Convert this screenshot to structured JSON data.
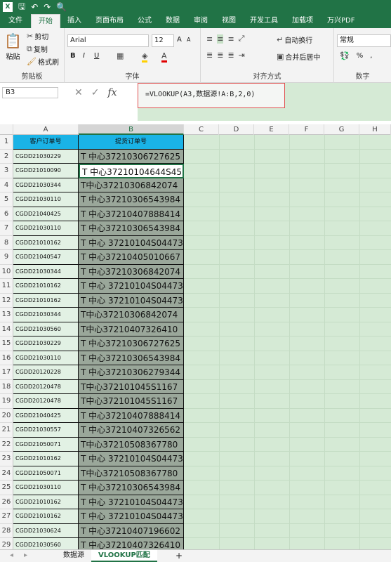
{
  "qat": {
    "logo": "X",
    "save": "🖫",
    "undo": "↶",
    "redo": "↷",
    "preview": "🔍"
  },
  "tabs": [
    "文件",
    "开始",
    "插入",
    "页面布局",
    "公式",
    "数据",
    "审阅",
    "视图",
    "开发工具",
    "加载项",
    "万兴PDF"
  ],
  "ribbon": {
    "clipboard": {
      "paste": "粘贴",
      "cut": "剪切",
      "copy": "复制",
      "painter": "格式刷",
      "label": "剪贴板"
    },
    "font": {
      "name": "Arial",
      "size": "12",
      "bold": "B",
      "italic": "I",
      "underline": "U",
      "grow": "A",
      "shrink": "A",
      "label": "字体"
    },
    "align": {
      "wrap": "自动换行",
      "merge": "合并后居中",
      "label": "对齐方式"
    },
    "number": {
      "format": "常规",
      "percent": "%",
      "comma": ",",
      "label": "数字"
    }
  },
  "namebox": "B3",
  "formula": "=VLOOKUP(A3,数据源!A:B,2,0)",
  "columns": [
    "A",
    "B",
    "C",
    "D",
    "E",
    "F",
    "G",
    "H"
  ],
  "header": {
    "a": "客户订单号",
    "b": "提货订单号"
  },
  "rows": [
    {
      "n": "1",
      "a": "",
      "b": ""
    },
    {
      "n": "2",
      "a": "CGDD21030229",
      "b": "T 中心37210306727625"
    },
    {
      "n": "3",
      "a": "CGDD21010090",
      "b": "T 中心37210104644S45"
    },
    {
      "n": "4",
      "a": "CGDD21030344",
      "b": "T中心37210306842074"
    },
    {
      "n": "5",
      "a": "CGDD21030110",
      "b": "T 中心37210306543984"
    },
    {
      "n": "6",
      "a": "CGDD21040425",
      "b": "T 中心37210407888414"
    },
    {
      "n": "7",
      "a": "CGDD21030110",
      "b": "T 中心37210306543984"
    },
    {
      "n": "8",
      "a": "CGDD21010162",
      "b": "T 中心 37210104S04473"
    },
    {
      "n": "9",
      "a": "CGDD21040547",
      "b": "T 中心37210405010667"
    },
    {
      "n": "10",
      "a": "CGDD21030344",
      "b": "T 中心37210306842074"
    },
    {
      "n": "11",
      "a": "CGDD21010162",
      "b": "T 中心 37210104S04473"
    },
    {
      "n": "12",
      "a": "CGDD21010162",
      "b": "T 中心 37210104S04473"
    },
    {
      "n": "13",
      "a": "CGDD21030344",
      "b": "T中心37210306842074"
    },
    {
      "n": "14",
      "a": "CGDD21030560",
      "b": "T中心37210407326410"
    },
    {
      "n": "15",
      "a": "CGDD21030229",
      "b": "T 中心37210306727625"
    },
    {
      "n": "16",
      "a": "CGDD21030110",
      "b": "T 中心37210306543984"
    },
    {
      "n": "17",
      "a": "CGDD20120228",
      "b": "T 中心37210306279344"
    },
    {
      "n": "18",
      "a": "CGDD20120478",
      "b": "T中心372101045S1167"
    },
    {
      "n": "19",
      "a": "CGDD20120478",
      "b": "T中心372101045S1167"
    },
    {
      "n": "20",
      "a": "CGDD21040425",
      "b": "T 中心37210407888414"
    },
    {
      "n": "21",
      "a": "CGDD21030557",
      "b": "T 中心37210407326562"
    },
    {
      "n": "22",
      "a": "CGDD21050071",
      "b": "T中心37210508367780"
    },
    {
      "n": "23",
      "a": "CGDD21010162",
      "b": "T 中心 37210104S04473"
    },
    {
      "n": "24",
      "a": "CGDD21050071",
      "b": "T中心37210508367780"
    },
    {
      "n": "25",
      "a": "CGDD21030110",
      "b": "T 中心37210306543984"
    },
    {
      "n": "26",
      "a": "CGDD21010162",
      "b": "T 中心 37210104S04473"
    },
    {
      "n": "27",
      "a": "CGDD21010162",
      "b": "T 中心 37210104S04473"
    },
    {
      "n": "28",
      "a": "CGDD21030624",
      "b": "T 中心37210407196602"
    },
    {
      "n": "29",
      "a": "CGDD21030560",
      "b": "T 中心37210407326410"
    }
  ],
  "sheets": {
    "tab1": "数据源",
    "tab2": "VLOOKUP匹配",
    "add": "+"
  }
}
